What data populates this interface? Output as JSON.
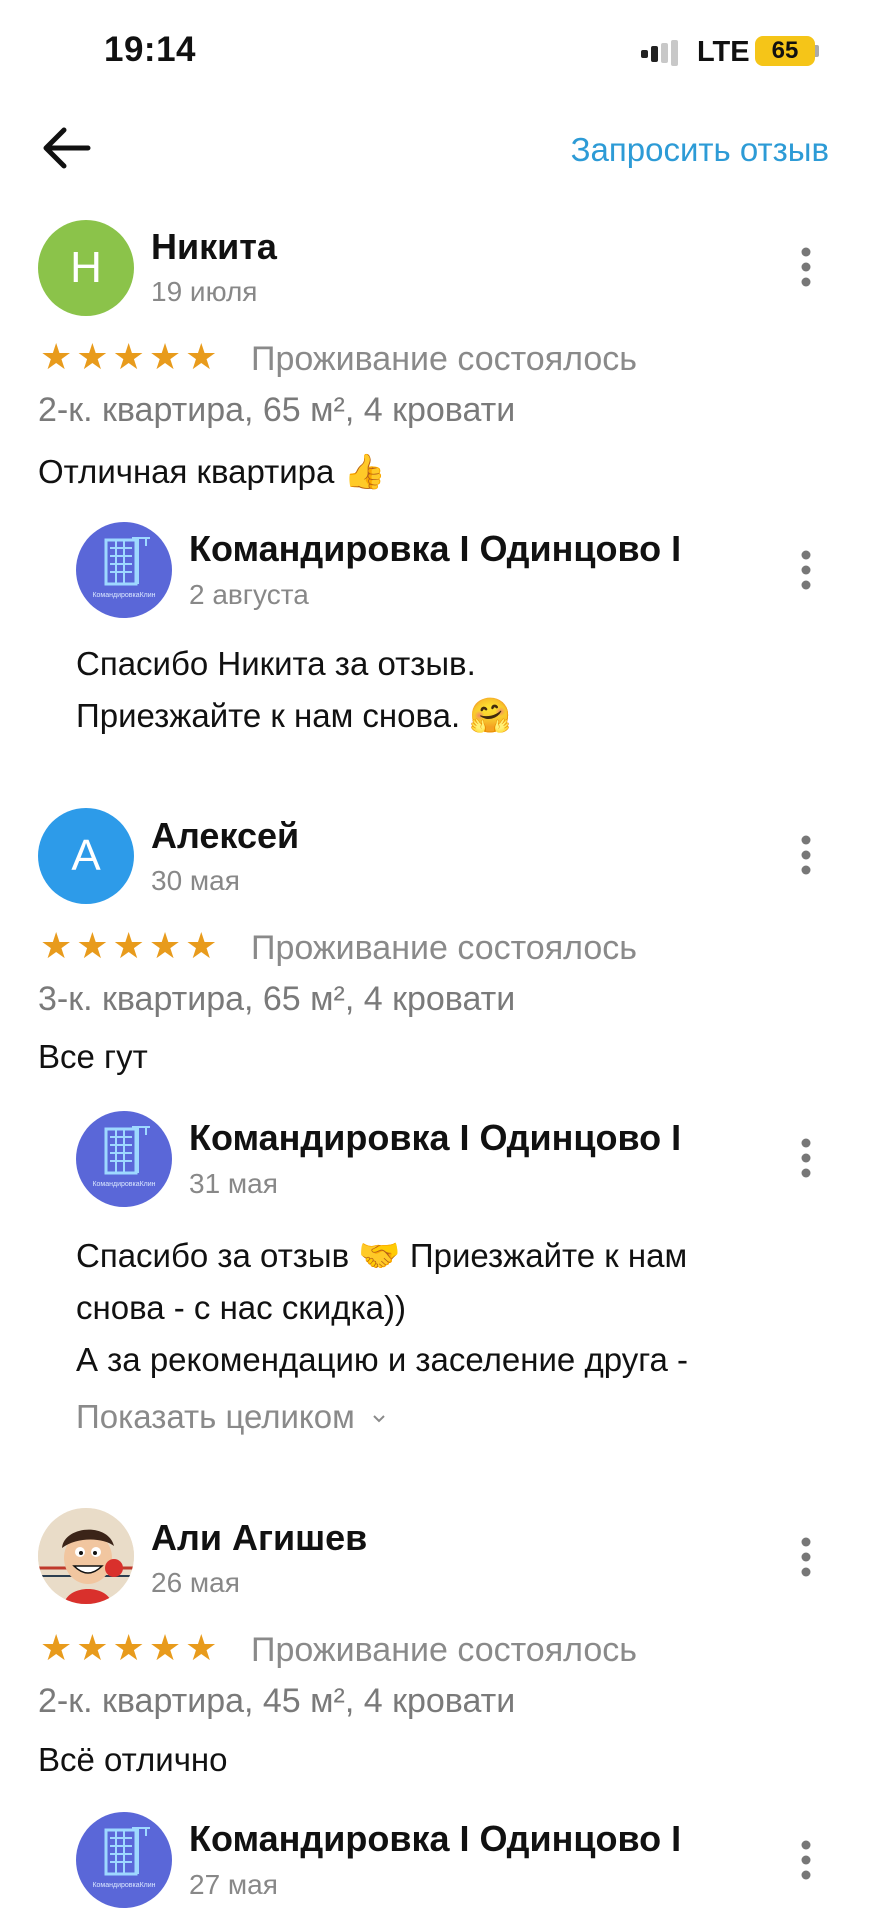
{
  "status_bar": {
    "time": "19:14",
    "network": "LTE",
    "battery": "65"
  },
  "header": {
    "request_review": "Запросить отзыв"
  },
  "reviews": [
    {
      "initial": "Н",
      "avatar_color": "#8bc34a",
      "name": "Никита",
      "date": "19 июля",
      "stars": "★★★★★",
      "status": "Проживание состоялось",
      "details": "2-к. квартира, 65 м², 4 кровати",
      "text": "Отличная квартира",
      "emoji": "👍",
      "reply": {
        "name": "Командировка I Одинцово I",
        "date": "2 августа",
        "lines": [
          "Спасибо Никита за отзыв.",
          "Приезжайте к нам снова."
        ],
        "emoji": "🤗"
      }
    },
    {
      "initial": "А",
      "avatar_color": "#2d9be9",
      "name": "Алексей",
      "date": "30 мая",
      "stars": "★★★★★",
      "status": "Проживание состоялось",
      "details": "3-к. квартира, 65 м², 4 кровати",
      "text": "Все гут",
      "reply": {
        "name": "Командировка I Одинцово I",
        "date": "31 мая",
        "line1_a": "Спасибо за отзыв",
        "line1_emoji": "🤝",
        "line1_b": "Приезжайте к нам",
        "line2": "снова - с нас скидка))",
        "line3": "А за рекомендацию и заселение друга -",
        "show_more": "Показать целиком"
      }
    },
    {
      "name": "Али Агишев",
      "date": "26 мая",
      "stars": "★★★★★",
      "status": "Проживание состоялось",
      "details": "2-к. квартира, 45 м², 4 кровати",
      "text": "Всё отлично",
      "reply": {
        "name": "Командировка I Одинцово I",
        "date": "27 мая"
      }
    }
  ],
  "owner_logo_caption": "КомандировкаКлин"
}
